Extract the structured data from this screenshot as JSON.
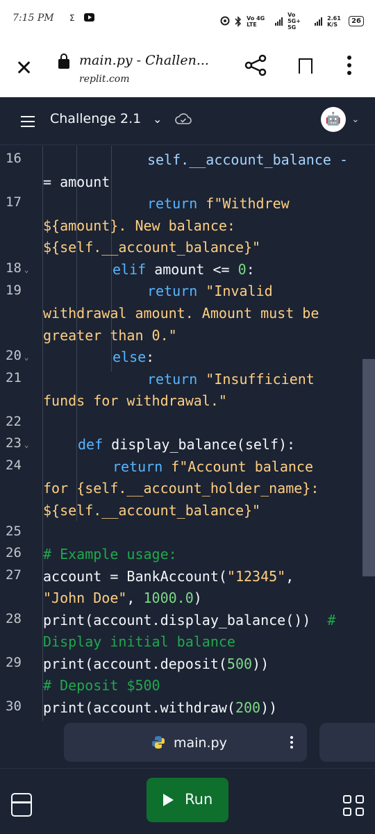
{
  "status": {
    "time": "7:15 PM",
    "sigma": "Σ",
    "net1": "Vo 4G LTE",
    "net2": "Vo 5G+ 5G",
    "speed": "2.61 K/S",
    "battery": "26"
  },
  "browser": {
    "title": "main.py - Challen...",
    "domain": "replit.com"
  },
  "toolbar": {
    "repl_name": "Challenge 2.1",
    "avatar": "🤖"
  },
  "editor": {
    "lines": [
      {
        "n": "16",
        "fold": false
      },
      {
        "n": "17",
        "fold": false
      },
      {
        "n": "18",
        "fold": true
      },
      {
        "n": "19",
        "fold": false
      },
      {
        "n": "20",
        "fold": true
      },
      {
        "n": "21",
        "fold": false
      },
      {
        "n": "22",
        "fold": false
      },
      {
        "n": "23",
        "fold": true
      },
      {
        "n": "24",
        "fold": false
      },
      {
        "n": "25",
        "fold": false
      },
      {
        "n": "26",
        "fold": false
      },
      {
        "n": "27",
        "fold": false
      },
      {
        "n": "28",
        "fold": false
      },
      {
        "n": "29",
        "fold": false
      },
      {
        "n": "30",
        "fold": false
      }
    ],
    "code": {
      "l16a": "self.__account_balance -",
      "l16b": "= amount",
      "l17a_kw": "return",
      "l17a_str": "f\"Withdrew",
      "l17b": "${amount}. New balance:",
      "l17c": "${self.__account_balance}\"",
      "l18_kw": "elif",
      "l18_rest": "amount <=",
      "l18_num": "0",
      "l18_end": ":",
      "l19a_kw": "return",
      "l19a_str": "\"Invalid",
      "l19b": "withdrawal amount. Amount must be",
      "l19c": "greater than 0.\"",
      "l20_kw": "else",
      "l20_end": ":",
      "l21a_kw": "return",
      "l21a_str": "\"Insufficient",
      "l21b": "funds for withdrawal.\"",
      "l23_kw": "def",
      "l23_fn": "display_balance(self):",
      "l24a_kw": "return",
      "l24a_str": "f\"Account balance",
      "l24b": "for {self.__account_holder_name}:",
      "l24c": "${self.__account_balance}\"",
      "l26": "# Example usage:",
      "l27a_1": "account = BankAccount(",
      "l27a_2": "\"12345\"",
      "l27a_3": ",",
      "l27b_1": "\"John Doe\"",
      "l27b_2": ", ",
      "l27b_3": "1000.0",
      "l27b_4": ")",
      "l28a_1": "print(account.display_balance())",
      "l28a_2": "#",
      "l28b": "Display initial balance",
      "l29a_1": "print(account.deposit(",
      "l29a_2": "500",
      "l29a_3": "))",
      "l29b": "# Deposit $500",
      "l30_1": "print(account.withdraw(",
      "l30_2": "200",
      "l30_3": "))"
    }
  },
  "tab": {
    "label": "main.py"
  },
  "run": {
    "label": "Run"
  }
}
